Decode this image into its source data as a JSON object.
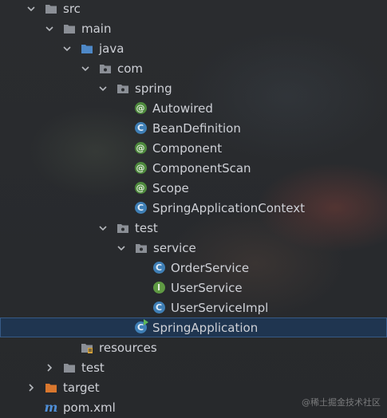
{
  "project_tree": {
    "items": [
      {
        "label": "src",
        "icon": "folder-icon",
        "expanded": true
      },
      {
        "label": "main",
        "icon": "folder-icon",
        "expanded": true
      },
      {
        "label": "java",
        "icon": "source-folder-icon",
        "expanded": true
      },
      {
        "label": "com",
        "icon": "package-icon",
        "expanded": true
      },
      {
        "label": "spring",
        "icon": "package-icon",
        "expanded": true
      },
      {
        "label": "Autowired",
        "icon": "annotation-icon"
      },
      {
        "label": "BeanDefinition",
        "icon": "class-icon"
      },
      {
        "label": "Component",
        "icon": "annotation-icon"
      },
      {
        "label": "ComponentScan",
        "icon": "annotation-icon"
      },
      {
        "label": "Scope",
        "icon": "annotation-icon"
      },
      {
        "label": "SpringApplicationContext",
        "icon": "class-icon"
      },
      {
        "label": "test",
        "icon": "package-icon",
        "expanded": true
      },
      {
        "label": "service",
        "icon": "package-icon",
        "expanded": true
      },
      {
        "label": "OrderService",
        "icon": "class-icon"
      },
      {
        "label": "UserService",
        "icon": "interface-icon"
      },
      {
        "label": "UserServiceImpl",
        "icon": "class-icon"
      },
      {
        "label": "SpringApplication",
        "icon": "runnable-class-icon",
        "selected": true
      },
      {
        "label": "resources",
        "icon": "resources-folder-icon"
      },
      {
        "label": "test",
        "icon": "folder-icon",
        "expanded": false
      },
      {
        "label": "target",
        "icon": "excluded-folder-icon",
        "expanded": false
      },
      {
        "label": "pom.xml",
        "icon": "maven-icon"
      }
    ]
  },
  "icon_glyphs": {
    "annotation": "@",
    "class": "C",
    "interface": "I",
    "maven": "m"
  },
  "colors": {
    "background": "#2b2d30",
    "selection": "#1f3550",
    "folder": "#8b8f96",
    "source_folder": "#4e88c7",
    "excluded_folder": "#d9772e",
    "annotation": "#4e8a3d",
    "class": "#3f7fb6",
    "interface": "#5f9a43"
  },
  "watermark": "@稀土掘金技术社区"
}
